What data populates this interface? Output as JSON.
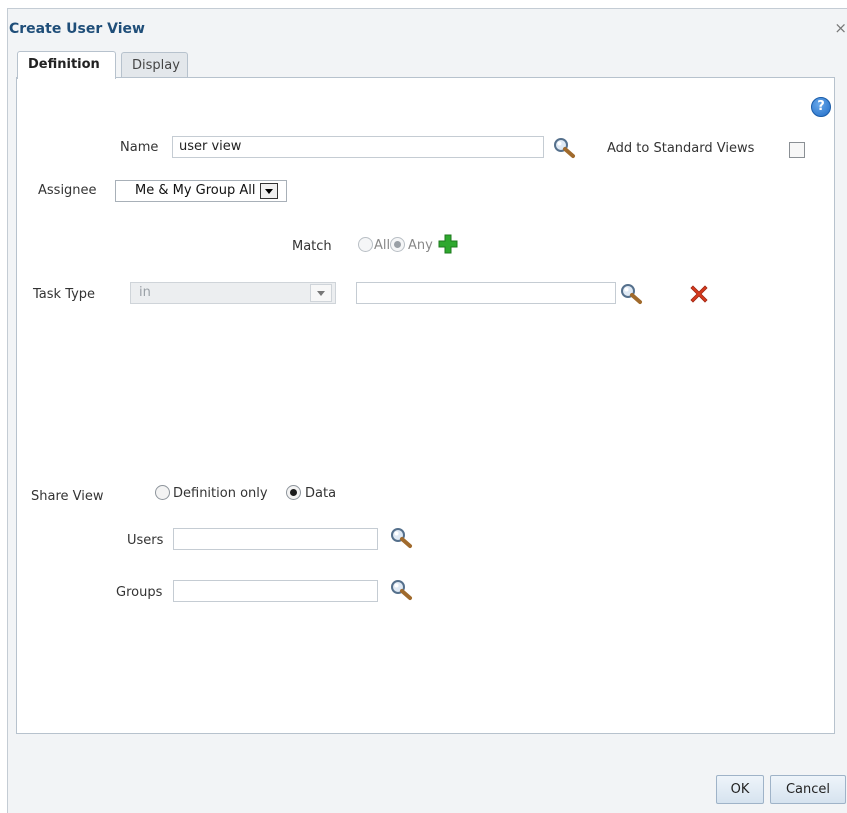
{
  "dialog": {
    "title": "Create User View",
    "close": "×"
  },
  "tabs": [
    {
      "label": "Definition",
      "active": true
    },
    {
      "label": "Display",
      "active": false
    }
  ],
  "help": {
    "glyph": "?"
  },
  "name_field": {
    "label": "Name",
    "value": "user view"
  },
  "standard_views": {
    "label": "Add to Standard Views",
    "checked": false
  },
  "assignee": {
    "label": "Assignee",
    "value": "Me & My Group All"
  },
  "match": {
    "label": "Match",
    "options": [
      "All",
      "Any"
    ],
    "selected": "Any"
  },
  "task_type": {
    "label": "Task Type",
    "operator": "in",
    "value": ""
  },
  "share_view": {
    "label": "Share View",
    "options": [
      "Definition only",
      "Data"
    ],
    "selected": "Data"
  },
  "users": {
    "label": "Users",
    "value": ""
  },
  "groups": {
    "label": "Groups",
    "value": ""
  },
  "buttons": {
    "ok": "OK",
    "cancel": "Cancel"
  },
  "colors": {
    "title": "#1f4e79",
    "add_icon": "#2ea82e",
    "delete_icon": "#d63a1e",
    "help_icon": "#1f6cc7"
  }
}
